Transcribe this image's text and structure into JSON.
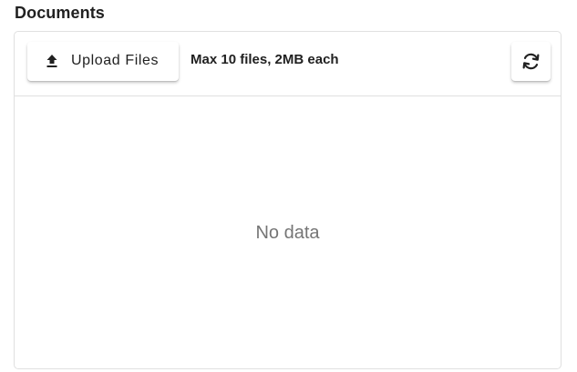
{
  "section": {
    "title": "Documents"
  },
  "toolbar": {
    "upload_label": "Upload Files",
    "upload_icon": "upload-icon",
    "limit_text": "Max 10 files, 2MB each",
    "refresh_icon": "refresh-icon"
  },
  "content": {
    "empty_text": "No data"
  },
  "colors": {
    "text": "#212121",
    "muted_text": "#757575",
    "border": "#e0e0e0"
  }
}
